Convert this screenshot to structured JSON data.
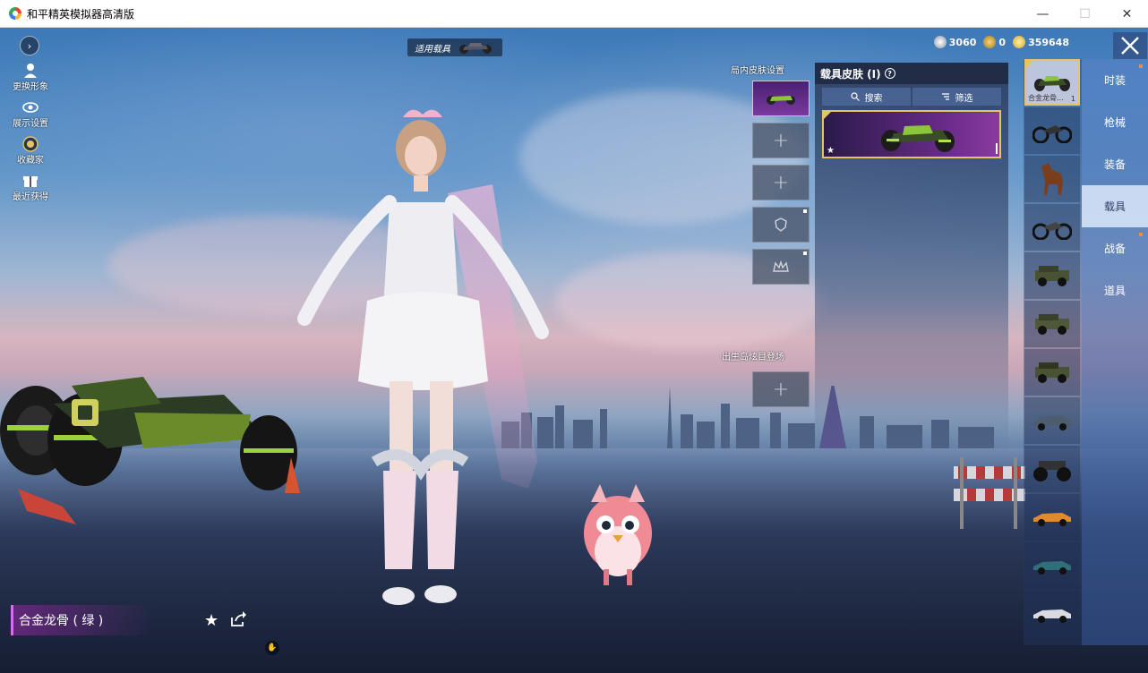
{
  "window": {
    "title": "和平精英模拟器高清版",
    "minimize_glyph": "—",
    "maximize_glyph": "☐",
    "close_glyph": "✕"
  },
  "left_menu": {
    "toggle_glyph": "›",
    "items": [
      {
        "label": "更换形象",
        "icon": "person-icon"
      },
      {
        "label": "展示设置",
        "icon": "eye-icon"
      },
      {
        "label": "收藏家",
        "icon": "badge-icon"
      },
      {
        "label": "最近获得",
        "icon": "gift-icon"
      }
    ]
  },
  "top": {
    "apply_vehicle_label": "适用载具"
  },
  "currency": [
    {
      "icon": "silver-coin-icon",
      "value": "3060",
      "color": "#c8ccd6"
    },
    {
      "icon": "a-coin-icon",
      "value": "0",
      "color": "#d7a43a"
    },
    {
      "icon": "gold-coin-icon",
      "value": "359648",
      "color": "#e6c04a"
    }
  ],
  "categories": [
    {
      "label": "时装",
      "dot": true
    },
    {
      "label": "枪械",
      "dot": false
    },
    {
      "label": "装备",
      "dot": false
    },
    {
      "label": "载具",
      "dot": false,
      "active": true
    },
    {
      "label": "战备",
      "dot": true
    },
    {
      "label": "道具",
      "dot": false
    }
  ],
  "vehicle_list": {
    "selected_caption": "合金龙骨...",
    "selected_count": "1",
    "items": [
      "kart-green",
      "motorcycle",
      "horse",
      "motorcycle-2",
      "jeep",
      "jeep-2",
      "jeep-3",
      "sedan",
      "monster-truck",
      "muscle-car-orange",
      "coupe-teal",
      "coupe-white"
    ]
  },
  "skin_panel": {
    "title": "载具皮肤 (I)",
    "search_label": "搜索",
    "filter_label": "筛选"
  },
  "ingame_skin": {
    "label": "局内皮肤设置",
    "plus_glyph": "+"
  },
  "spawn": {
    "label": "出生岛炫目登场",
    "plus_glyph": "+"
  },
  "selected_item": {
    "name": "合金龙骨 ( 绿 )"
  },
  "colors": {
    "accent_gold": "#e5c463",
    "active_tab_bg": "#d2e1f5",
    "name_bar": "#d66ef0"
  }
}
